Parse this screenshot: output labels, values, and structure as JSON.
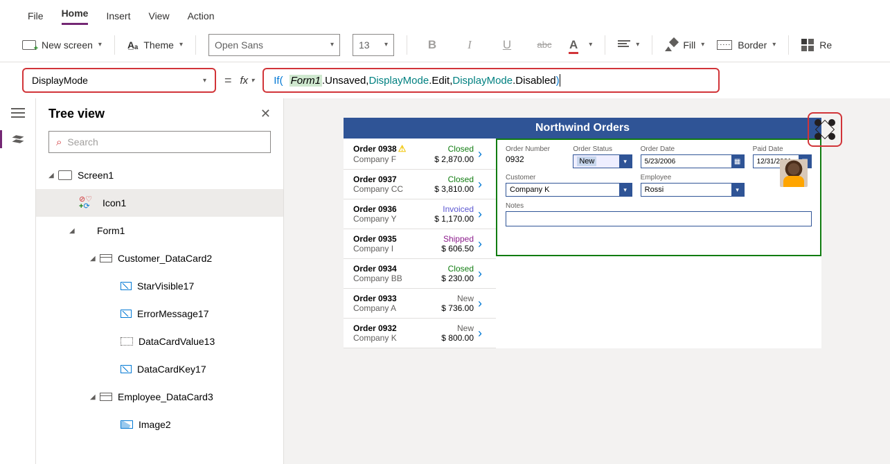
{
  "menu": {
    "file": "File",
    "home": "Home",
    "insert": "Insert",
    "view": "View",
    "action": "Action"
  },
  "ribbon": {
    "new_screen": "New screen",
    "theme": "Theme",
    "font": "Open Sans",
    "font_size": "13",
    "fill": "Fill",
    "border": "Border",
    "reorder": "Re"
  },
  "property": "DisplayMode",
  "formula": {
    "if": "If",
    "open": "(",
    "param": "Form1",
    "text1": ".Unsaved, ",
    "dm1": "DisplayMode",
    "text2": ".Edit, ",
    "dm2": "DisplayMode",
    "text3": ".Disabled ",
    "close": ")"
  },
  "tree": {
    "title": "Tree view",
    "search_placeholder": "Search",
    "items": {
      "screen1": "Screen1",
      "icon1": "Icon1",
      "form1": "Form1",
      "custcard": "Customer_DataCard2",
      "starvis": "StarVisible17",
      "errmsg": "ErrorMessage17",
      "dcval": "DataCardValue13",
      "dckey": "DataCardKey17",
      "empcard": "Employee_DataCard3",
      "image2": "Image2"
    }
  },
  "canvas": {
    "title": "Northwind Orders",
    "orders": [
      {
        "num": "Order 0938",
        "warn": true,
        "status": "Closed",
        "status_cls": "closed",
        "co": "Company F",
        "amt": "$ 2,870.00"
      },
      {
        "num": "Order 0937",
        "status": "Closed",
        "status_cls": "closed",
        "co": "Company CC",
        "amt": "$ 3,810.00"
      },
      {
        "num": "Order 0936",
        "status": "Invoiced",
        "status_cls": "invoiced",
        "co": "Company Y",
        "amt": "$ 1,170.00"
      },
      {
        "num": "Order 0935",
        "status": "Shipped",
        "status_cls": "shipped",
        "co": "Company I",
        "amt": "$ 606.50"
      },
      {
        "num": "Order 0934",
        "status": "Closed",
        "status_cls": "closed",
        "co": "Company BB",
        "amt": "$ 230.00"
      },
      {
        "num": "Order 0933",
        "status": "New",
        "status_cls": "new",
        "co": "Company A",
        "amt": "$ 736.00"
      },
      {
        "num": "Order 0932",
        "status": "New",
        "status_cls": "new",
        "co": "Company K",
        "amt": "$ 800.00"
      }
    ],
    "form": {
      "labels": {
        "ordnum": "Order Number",
        "ordstatus": "Order Status",
        "orddate": "Order Date",
        "paiddate": "Paid Date",
        "customer": "Customer",
        "employee": "Employee",
        "notes": "Notes"
      },
      "order_number": "0932",
      "order_status": "New",
      "order_date": "5/23/2006",
      "paid_date": "12/31/2001",
      "customer": "Company K",
      "employee": "Rossi"
    }
  }
}
